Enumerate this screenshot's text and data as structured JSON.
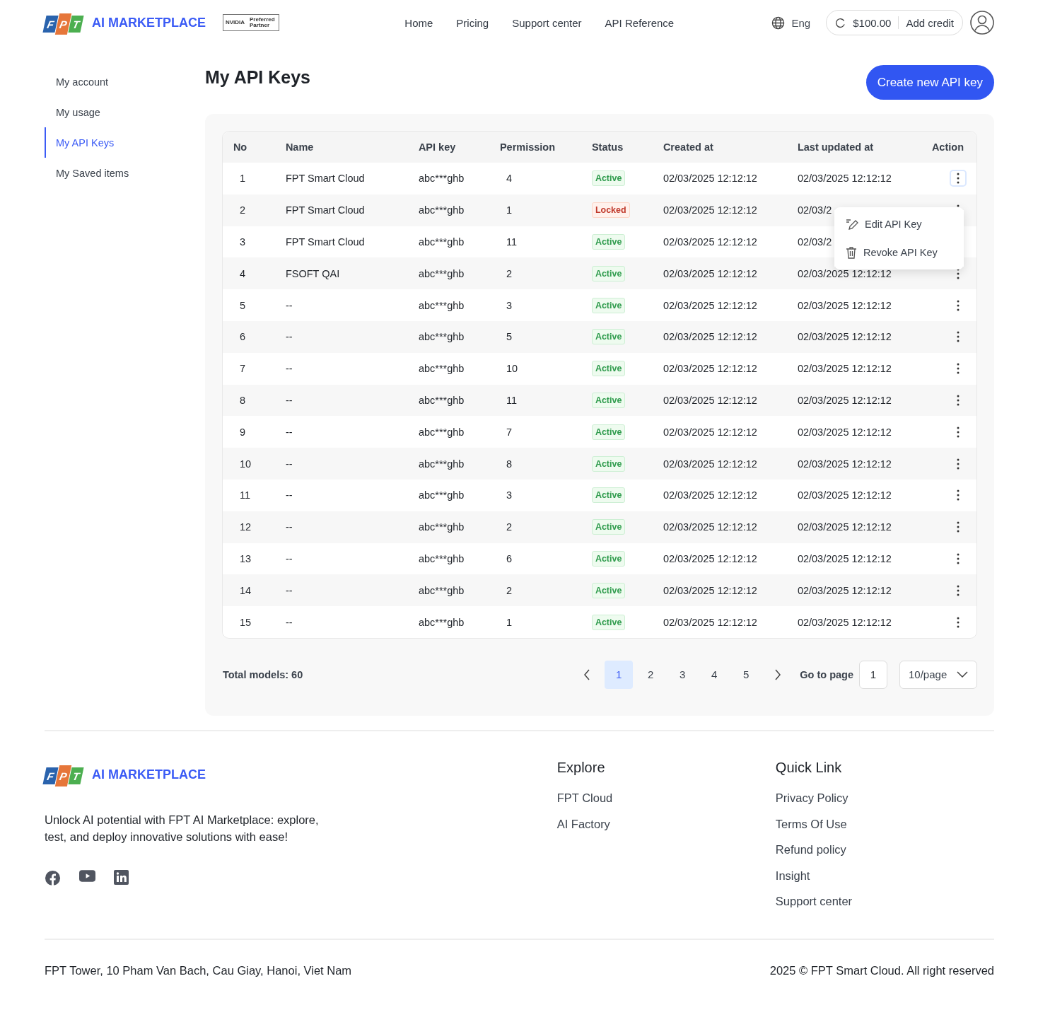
{
  "header": {
    "brand": {
      "logo_letters": [
        "F",
        "P",
        "T"
      ],
      "name": "AI MARKETPLACE"
    },
    "partner_badge": {
      "brand": "NVIDIA",
      "text": "Preferred Partner"
    },
    "nav": [
      "Home",
      "Pricing",
      "Support center",
      "API Reference"
    ],
    "language": "Eng",
    "balance": "$100.00",
    "add_credit": "Add credit"
  },
  "sidebar": {
    "items": [
      {
        "label": "My account",
        "selected": false
      },
      {
        "label": "My usage",
        "selected": false
      },
      {
        "label": "My API Keys",
        "selected": true
      },
      {
        "label": "My Saved items",
        "selected": false
      }
    ]
  },
  "page_title": "My API Keys",
  "create_button": "Create new API key",
  "table": {
    "columns": [
      "No",
      "Name",
      "API key",
      "Permission",
      "Status",
      "Created at",
      "Last updated at",
      "Action"
    ],
    "rows": [
      {
        "no": "1",
        "name": "FPT Smart Cloud",
        "api_key": "abc***ghb",
        "permission": "4",
        "status": {
          "label": "Active",
          "kind": "active"
        },
        "created_at": "02/03/2025 12:12:12",
        "last_updated_at": "02/03/2025 12:12:12",
        "menu_open": true
      },
      {
        "no": "2",
        "name": "FPT Smart Cloud",
        "api_key": "abc***ghb",
        "permission": "1",
        "status": {
          "label": "Locked",
          "kind": "locked"
        },
        "created_at": "02/03/2025 12:12:12",
        "last_updated_at": "02/03/2",
        "menu_open": false
      },
      {
        "no": "3",
        "name": "FPT Smart Cloud",
        "api_key": "abc***ghb",
        "permission": "11",
        "status": {
          "label": "Active",
          "kind": "active"
        },
        "created_at": "02/03/2025 12:12:12",
        "last_updated_at": "02/03/2",
        "menu_open": false
      },
      {
        "no": "4",
        "name": "FSOFT QAI",
        "api_key": "abc***ghb",
        "permission": "2",
        "status": {
          "label": "Active",
          "kind": "active"
        },
        "created_at": "02/03/2025 12:12:12",
        "last_updated_at": "02/03/2025 12:12:12",
        "menu_open": false
      },
      {
        "no": "5",
        "name": "--",
        "api_key": "abc***ghb",
        "permission": "3",
        "status": {
          "label": "Active",
          "kind": "active"
        },
        "created_at": "02/03/2025 12:12:12",
        "last_updated_at": "02/03/2025 12:12:12",
        "menu_open": false
      },
      {
        "no": "6",
        "name": "--",
        "api_key": "abc***ghb",
        "permission": "5",
        "status": {
          "label": "Active",
          "kind": "active"
        },
        "created_at": "02/03/2025 12:12:12",
        "last_updated_at": "02/03/2025 12:12:12",
        "menu_open": false
      },
      {
        "no": "7",
        "name": "--",
        "api_key": "abc***ghb",
        "permission": "10",
        "status": {
          "label": "Active",
          "kind": "active"
        },
        "created_at": "02/03/2025 12:12:12",
        "last_updated_at": "02/03/2025 12:12:12",
        "menu_open": false
      },
      {
        "no": "8",
        "name": "--",
        "api_key": "abc***ghb",
        "permission": "11",
        "status": {
          "label": "Active",
          "kind": "active"
        },
        "created_at": "02/03/2025 12:12:12",
        "last_updated_at": "02/03/2025 12:12:12",
        "menu_open": false
      },
      {
        "no": "9",
        "name": "--",
        "api_key": "abc***ghb",
        "permission": "7",
        "status": {
          "label": "Active",
          "kind": "active"
        },
        "created_at": "02/03/2025 12:12:12",
        "last_updated_at": "02/03/2025 12:12:12",
        "menu_open": false
      },
      {
        "no": "10",
        "name": "--",
        "api_key": "abc***ghb",
        "permission": "8",
        "status": {
          "label": "Active",
          "kind": "active"
        },
        "created_at": "02/03/2025 12:12:12",
        "last_updated_at": "02/03/2025 12:12:12",
        "menu_open": false
      },
      {
        "no": "11",
        "name": "--",
        "api_key": "abc***ghb",
        "permission": "3",
        "status": {
          "label": "Active",
          "kind": "active"
        },
        "created_at": "02/03/2025 12:12:12",
        "last_updated_at": "02/03/2025 12:12:12",
        "menu_open": false
      },
      {
        "no": "12",
        "name": "--",
        "api_key": "abc***ghb",
        "permission": "2",
        "status": {
          "label": "Active",
          "kind": "active"
        },
        "created_at": "02/03/2025 12:12:12",
        "last_updated_at": "02/03/2025 12:12:12",
        "menu_open": false
      },
      {
        "no": "13",
        "name": "--",
        "api_key": "abc***ghb",
        "permission": "6",
        "status": {
          "label": "Active",
          "kind": "active"
        },
        "created_at": "02/03/2025 12:12:12",
        "last_updated_at": "02/03/2025 12:12:12",
        "menu_open": false
      },
      {
        "no": "14",
        "name": "--",
        "api_key": "abc***ghb",
        "permission": "2",
        "status": {
          "label": "Active",
          "kind": "active"
        },
        "created_at": "02/03/2025 12:12:12",
        "last_updated_at": "02/03/2025 12:12:12",
        "menu_open": false
      },
      {
        "no": "15",
        "name": "--",
        "api_key": "abc***ghb",
        "permission": "1",
        "status": {
          "label": "Active",
          "kind": "active"
        },
        "created_at": "02/03/2025 12:12:12",
        "last_updated_at": "02/03/2025 12:12:12",
        "menu_open": false
      }
    ]
  },
  "action_menu": {
    "items": [
      {
        "label": "Edit API Key",
        "kind": "edit"
      },
      {
        "label": "Revoke API Key",
        "kind": "revoke"
      }
    ]
  },
  "pagination": {
    "total": "Total models: 60",
    "pages": [
      {
        "label": "1",
        "selected": true
      },
      {
        "label": "2",
        "selected": false
      },
      {
        "label": "3",
        "selected": false
      },
      {
        "label": "4",
        "selected": false
      },
      {
        "label": "5",
        "selected": false
      }
    ],
    "go_to_label": "Go to page",
    "go_to_value": "1",
    "page_size": "10/page"
  },
  "footer": {
    "brand": {
      "logo_letters": [
        "F",
        "P",
        "T"
      ],
      "name": "AI MARKETPLACE"
    },
    "tagline": "Unlock AI potential with FPT AI Marketplace: explore, test, and deploy innovative solutions with ease!",
    "social": [
      {
        "kind": "facebook"
      },
      {
        "kind": "youtube"
      },
      {
        "kind": "linkedin"
      }
    ],
    "explore": {
      "title": "Explore",
      "links": [
        "FPT Cloud",
        "AI Factory"
      ]
    },
    "quick_link": {
      "title": "Quick Link",
      "links": [
        "Privacy Policy",
        "Terms Of Use",
        "Refund policy",
        "Insight",
        "Support center"
      ]
    },
    "address": "FPT Tower, 10 Pham Van Bach, Cau Giay, Hanoi, Viet Nam",
    "copyright": "2025 © FPT Smart Cloud. All right reserved"
  }
}
